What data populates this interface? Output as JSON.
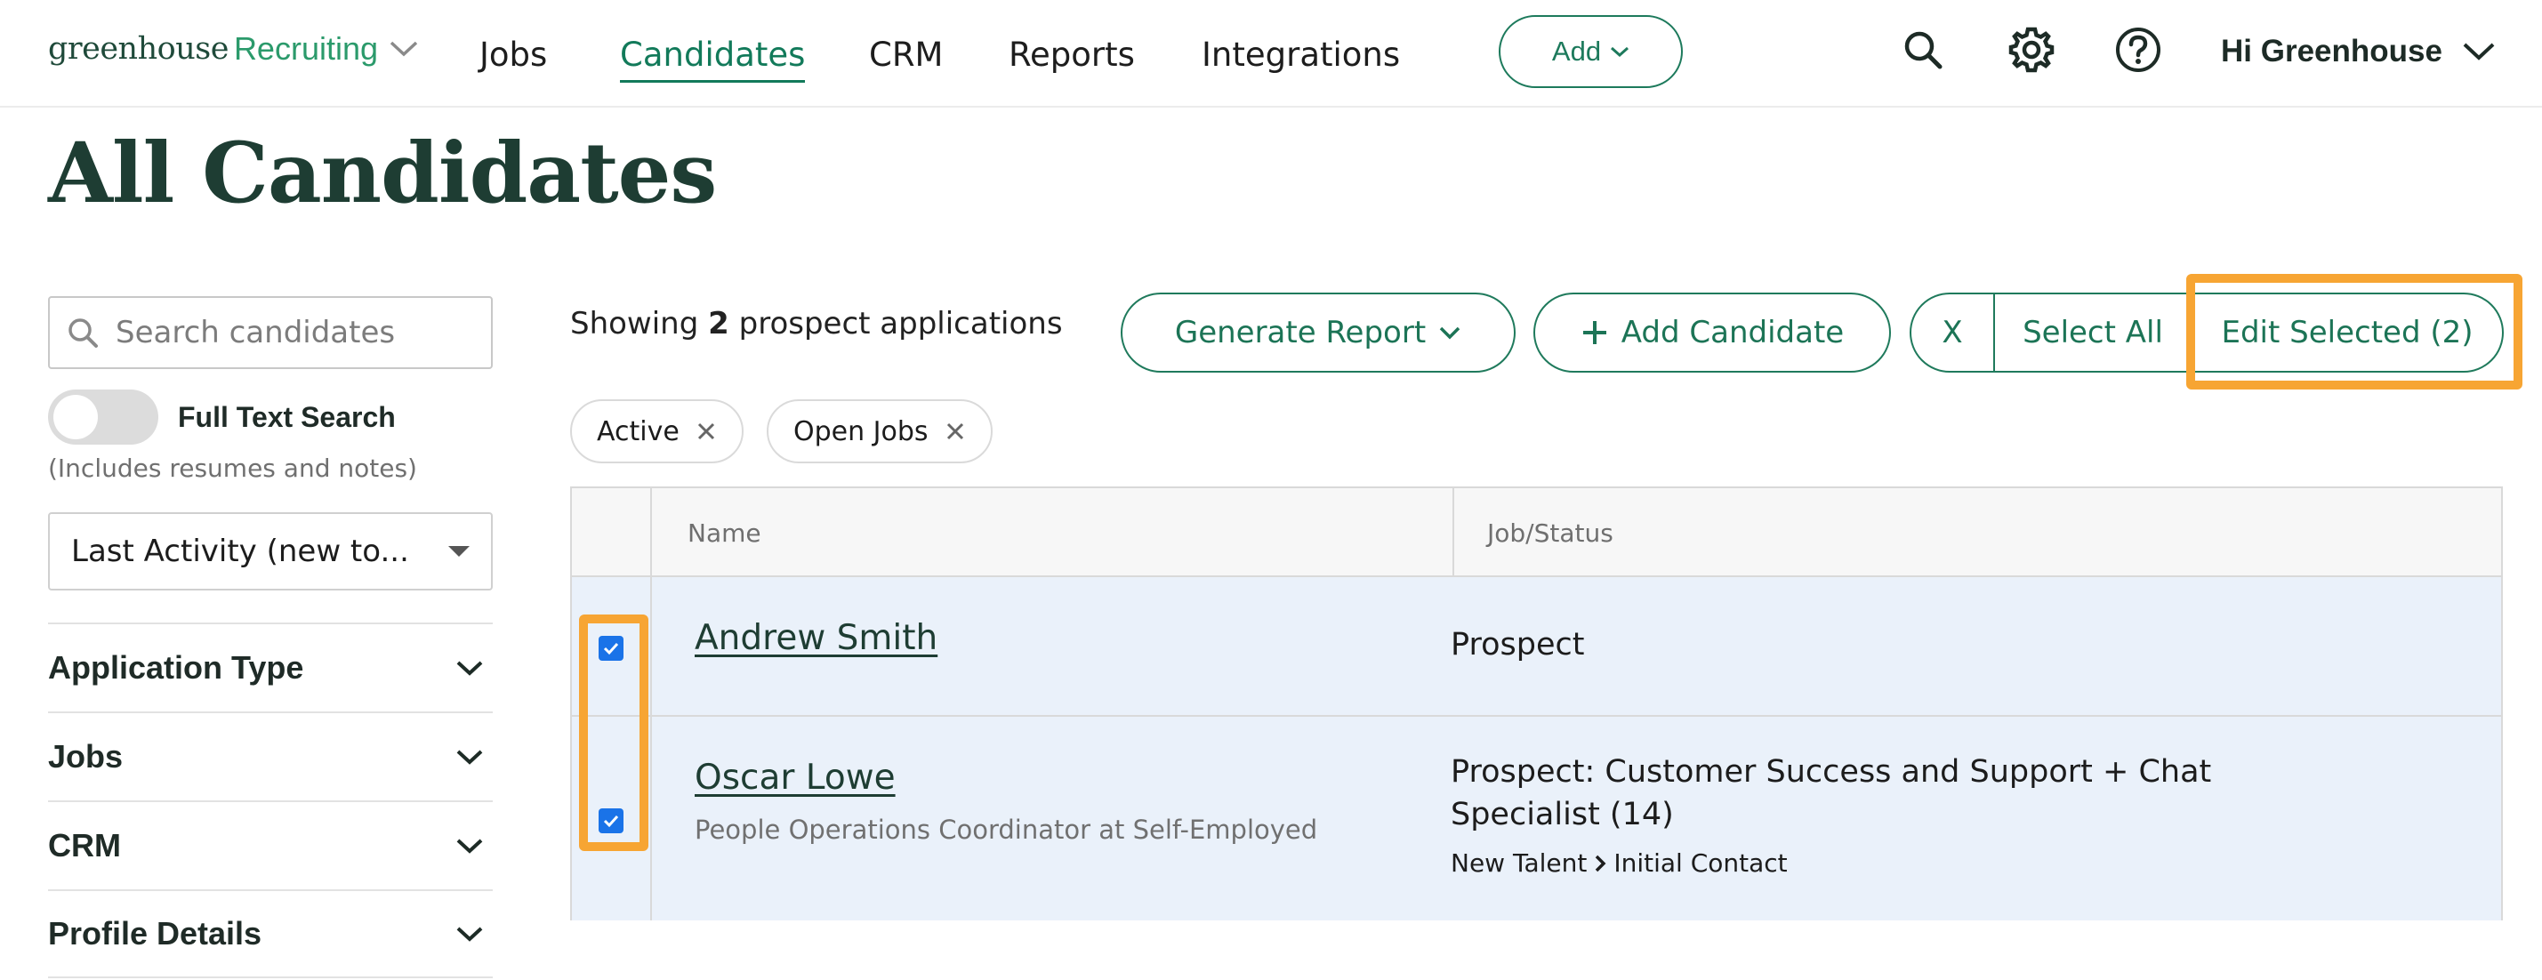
{
  "nav": {
    "logo_text": "greenhouse",
    "logo_product": "Recruiting",
    "links": [
      "Jobs",
      "Candidates",
      "CRM",
      "Reports",
      "Integrations"
    ],
    "active_link": "Candidates",
    "add_label": "Add",
    "user_greeting": "Hi Greenhouse",
    "icons": [
      "search-icon",
      "gear-icon",
      "help-icon"
    ]
  },
  "page": {
    "title": "All Candidates"
  },
  "sidebar": {
    "search_placeholder": "Search candidates",
    "full_text_label": "Full Text Search",
    "full_text_on": false,
    "full_text_hint": "(Includes resumes and notes)",
    "sort_value": "Last Activity (new to...",
    "sections": [
      "Application Type",
      "Jobs",
      "CRM",
      "Profile Details"
    ]
  },
  "toolbar": {
    "showing_prefix": "Showing",
    "showing_count": "2",
    "showing_suffix": "prospect applications",
    "generate_report": "Generate Report",
    "add_candidate": "Add Candidate",
    "clear_label": "X",
    "select_all": "Select All",
    "edit_selected": "Edit Selected (2)"
  },
  "filters": [
    "Active",
    "Open Jobs"
  ],
  "table": {
    "columns": [
      "Name",
      "Job/Status"
    ],
    "rows": [
      {
        "name": "Andrew Smith",
        "subtitle": "",
        "job": "Prospect",
        "job_line2": "",
        "stage_from": "",
        "stage_to": "",
        "checked": true
      },
      {
        "name": "Oscar Lowe",
        "subtitle": "People Operations Coordinator at Self-Employed",
        "job": "Prospect: Customer Success and Support + Chat",
        "job_line2": "Specialist (14)",
        "stage_from": "New Talent",
        "stage_to": "Initial Contact",
        "checked": true
      }
    ]
  },
  "colors": {
    "brand": "#1d7a5c",
    "highlight": "#f7a533",
    "row_selected": "#eaf1fa",
    "checkbox": "#1a73e8"
  }
}
